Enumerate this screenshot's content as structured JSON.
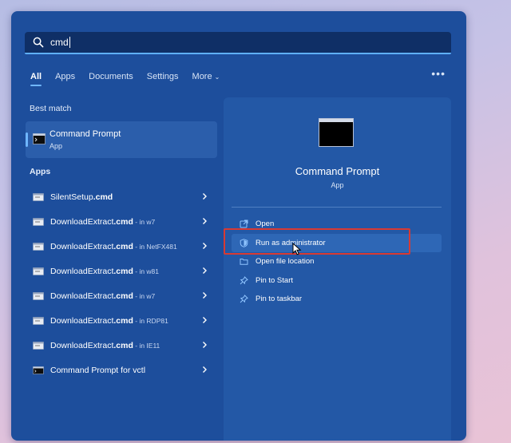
{
  "search": {
    "value": "cmd"
  },
  "tabs": [
    {
      "label": "All",
      "active": true
    },
    {
      "label": "Apps"
    },
    {
      "label": "Documents"
    },
    {
      "label": "Settings"
    },
    {
      "label": "More"
    }
  ],
  "best_match": {
    "heading": "Best match",
    "name": "Command Prompt",
    "type": "App"
  },
  "apps": {
    "heading": "Apps",
    "items": [
      {
        "name": "SilentSetup",
        "ext": ".cmd",
        "suffix": ""
      },
      {
        "name": "DownloadExtract",
        "ext": ".cmd",
        "suffix": " - in w7"
      },
      {
        "name": "DownloadExtract",
        "ext": ".cmd",
        "suffix": " - in NetFX481"
      },
      {
        "name": "DownloadExtract",
        "ext": ".cmd",
        "suffix": " - in w81"
      },
      {
        "name": "DownloadExtract",
        "ext": ".cmd",
        "suffix": " - in w7"
      },
      {
        "name": "DownloadExtract",
        "ext": ".cmd",
        "suffix": " - in RDP81"
      },
      {
        "name": "DownloadExtract",
        "ext": ".cmd",
        "suffix": " - in IE11"
      },
      {
        "name": "Command Prompt for vctl",
        "ext": "",
        "suffix": ""
      }
    ]
  },
  "detail": {
    "title": "Command Prompt",
    "subtitle": "App",
    "actions": [
      {
        "label": "Open",
        "icon": "open-icon"
      },
      {
        "label": "Run as administrator",
        "icon": "shield-icon"
      },
      {
        "label": "Open file location",
        "icon": "folder-icon"
      },
      {
        "label": "Pin to Start",
        "icon": "pin-icon"
      },
      {
        "label": "Pin to taskbar",
        "icon": "pin-icon"
      }
    ]
  },
  "colors": {
    "panel": "#1d4e9c",
    "accent": "#6fb6ff",
    "highlight_box": "#d83a33"
  }
}
